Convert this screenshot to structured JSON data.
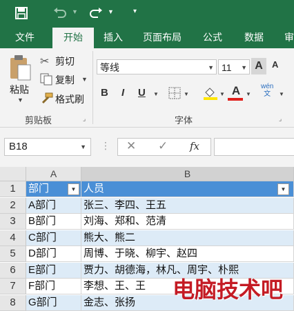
{
  "tabs": [
    "文件",
    "开始",
    "插入",
    "页面布局",
    "公式",
    "数据",
    "审"
  ],
  "clipboard": {
    "paste": "粘贴",
    "cut": "剪切",
    "copy": "复制",
    "format_painter": "格式刷",
    "group": "剪贴板"
  },
  "font": {
    "name": "等线",
    "size": "11",
    "group": "字体",
    "bold": "B",
    "italic": "I",
    "underline": "U",
    "grow": "A",
    "shrink": "A",
    "color_a": "A",
    "wen": "wén\n文"
  },
  "formula_bar": {
    "name_box": "B18",
    "fx": "fx"
  },
  "columns": [
    "A",
    "B"
  ],
  "rows": [
    {
      "num": "1",
      "a": "部门",
      "b": "人员"
    },
    {
      "num": "2",
      "a": "A部门",
      "b": "张三、李四、王五"
    },
    {
      "num": "3",
      "a": "B部门",
      "b": "刘海、郑和、范清"
    },
    {
      "num": "4",
      "a": "C部门",
      "b": "熊大、熊二"
    },
    {
      "num": "5",
      "a": "D部门",
      "b": "周博、于晓、柳宇、赵四"
    },
    {
      "num": "6",
      "a": "E部门",
      "b": "贾力、胡德海，林凡、周宇、朴熙"
    },
    {
      "num": "7",
      "a": "F部门",
      "b": "李想、王、王"
    },
    {
      "num": "8",
      "a": "G部门",
      "b": "金志、张扬"
    }
  ],
  "watermark": "电脑技术吧",
  "colors": {
    "excel_green": "#217346",
    "header_blue": "#4a8fd6",
    "band": "#ddebf7"
  }
}
